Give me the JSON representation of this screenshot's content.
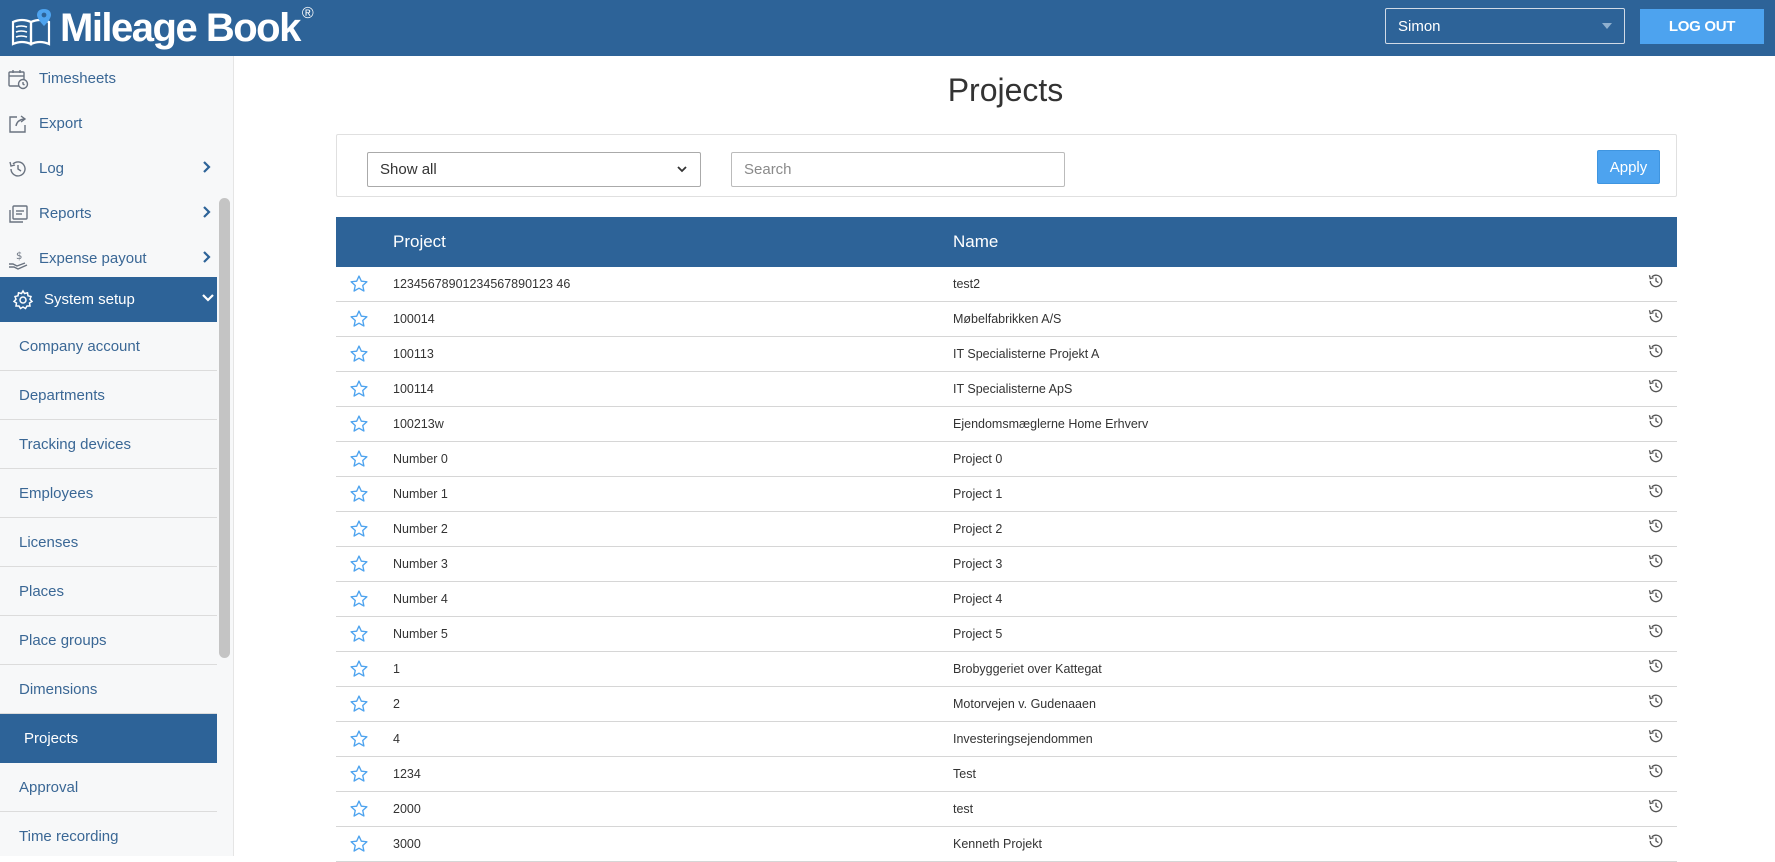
{
  "header": {
    "logo_text": "Mileage Book",
    "logo_reg": "®",
    "user_selected": "Simon",
    "logout_label": "LOG OUT"
  },
  "sidebar": {
    "top_items": [
      {
        "label": "Timesheets",
        "icon": "calendar-clock-icon",
        "has_chevron": false
      },
      {
        "label": "Export",
        "icon": "export-icon",
        "has_chevron": false
      },
      {
        "label": "Log",
        "icon": "history-icon",
        "has_chevron": true
      },
      {
        "label": "Reports",
        "icon": "reports-icon",
        "has_chevron": true
      },
      {
        "label": "Expense payout",
        "icon": "hand-dollar-icon",
        "has_chevron": true
      }
    ],
    "setup_label": "System setup",
    "sub_items": [
      "Company account",
      "Departments",
      "Tracking devices",
      "Employees",
      "Licenses",
      "Places",
      "Place groups",
      "Dimensions",
      "Projects",
      "Approval",
      "Time recording"
    ],
    "active_sub": "Projects"
  },
  "main": {
    "title": "Projects",
    "filter": {
      "selected": "Show all",
      "search_placeholder": "Search",
      "apply_label": "Apply"
    },
    "table": {
      "headers": {
        "project": "Project",
        "name": "Name"
      },
      "rows": [
        {
          "project": "12345678901234567890123 46",
          "name": "test2"
        },
        {
          "project": "100014",
          "name": "Møbelfabrikken A/S"
        },
        {
          "project": "100113",
          "name": "IT Specialisterne Projekt A"
        },
        {
          "project": "100114",
          "name": "IT Specialisterne ApS"
        },
        {
          "project": "100213w",
          "name": "Ejendomsmæglerne Home Erhverv"
        },
        {
          "project": "Number 0",
          "name": "Project 0"
        },
        {
          "project": "Number 1",
          "name": "Project 1"
        },
        {
          "project": "Number 2",
          "name": "Project 2"
        },
        {
          "project": "Number 3",
          "name": "Project 3"
        },
        {
          "project": "Number 4",
          "name": "Project 4"
        },
        {
          "project": "Number 5",
          "name": "Project 5"
        },
        {
          "project": "1",
          "name": "Brobyggeriet over Kattegat"
        },
        {
          "project": "2",
          "name": "Motorvejen v. Gudenaaen"
        },
        {
          "project": "4",
          "name": "Investeringsejendommen"
        },
        {
          "project": "1234",
          "name": "Test"
        },
        {
          "project": "2000",
          "name": "test"
        },
        {
          "project": "3000",
          "name": "Kenneth Projekt"
        }
      ]
    }
  },
  "colors": {
    "brand": "#2d6398",
    "accent": "#4da3ef",
    "star": "#4da3ef"
  }
}
